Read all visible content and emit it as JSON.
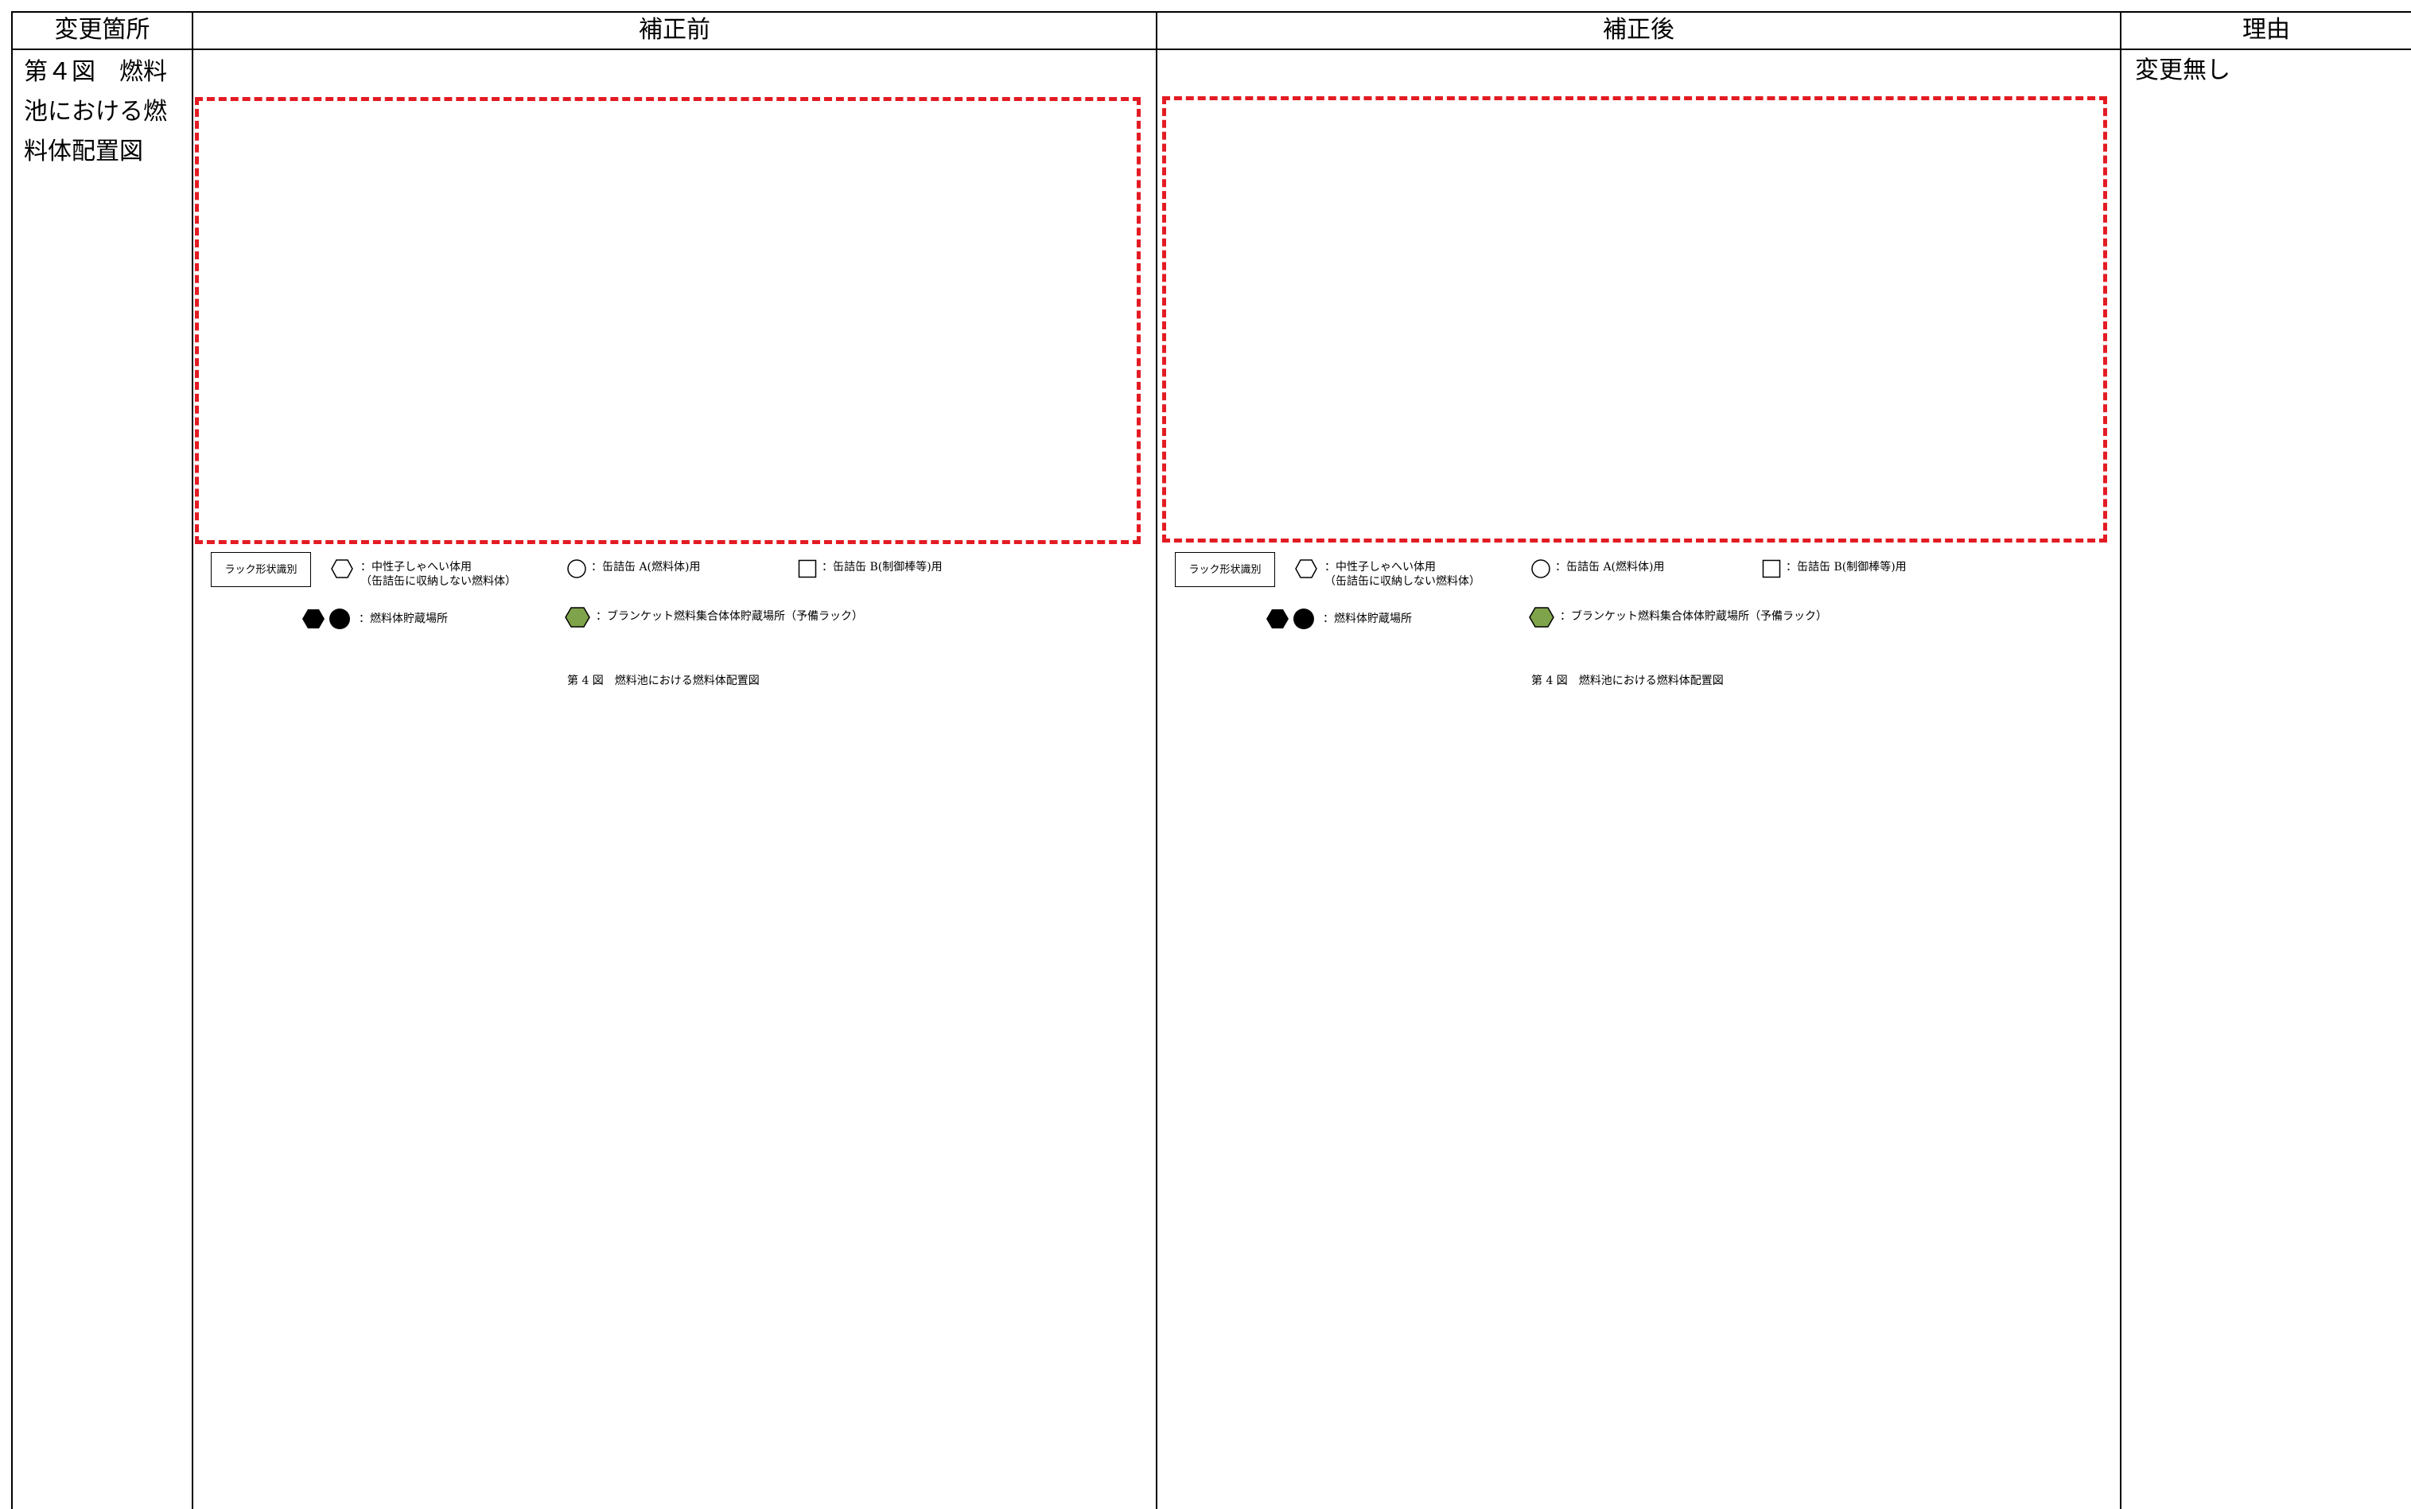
{
  "header": {
    "location": "変更箇所",
    "before": "補正前",
    "after": "補正後",
    "reason": "理由"
  },
  "row": {
    "location": "第４図　燃料池における燃料体配置図",
    "reason": "変更無し"
  },
  "legend": {
    "rack_label": "ラック形状識別",
    "neutron_shield_line1": "：中性子しゃへい体用",
    "neutron_shield_line2": "（缶詰缶に収納しない燃料体）",
    "can_a": "：缶詰缶 A(燃料体)用",
    "can_b": "：缶詰缶 B(制御棒等)用",
    "fuel_storage": "：燃料体貯蔵場所",
    "blanket_storage": "：ブランケット燃料集合体体貯蔵場所（予備ラック）"
  },
  "caption": "第 4 図　燃料池における燃料体配置図",
  "colors": {
    "highlight_dashed": "#e31b23",
    "blanket_symbol": "#7fa34a"
  },
  "icons": [
    "hexagon-outline-icon",
    "circle-outline-icon",
    "square-outline-icon",
    "hexagon-filled-icon",
    "circle-filled-icon",
    "hexagon-green-icon"
  ]
}
